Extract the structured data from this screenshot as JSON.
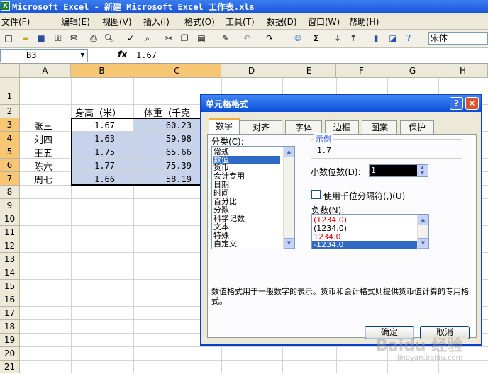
{
  "window": {
    "title": "Microsoft Excel - 新建 Microsoft Excel 工作表.xls",
    "app_icon": "X"
  },
  "menu": [
    "文件(F)",
    "编辑(E)",
    "视图(V)",
    "插入(I)",
    "格式(O)",
    "工具(T)",
    "数据(D)",
    "窗口(W)",
    "帮助(H)"
  ],
  "toolbar": {
    "font": "宋体",
    "sigma": "Σ"
  },
  "formula_bar": {
    "cell_ref": "B3",
    "fx": "fx",
    "value": "1.67"
  },
  "sheet": {
    "columns": [
      "A",
      "B",
      "C",
      "D",
      "E",
      "F",
      "G",
      "H"
    ],
    "rows": [
      "1",
      "2",
      "3",
      "4",
      "5",
      "6",
      "7",
      "8",
      "9",
      "10",
      "11",
      "12",
      "13",
      "14",
      "15",
      "16",
      "17",
      "18",
      "19",
      "20",
      "21"
    ],
    "headers": {
      "height": "身高（米）",
      "weight": "体重（千克"
    },
    "data": [
      {
        "name": "张三",
        "height": "1.67",
        "weight": "60.23"
      },
      {
        "name": "刘四",
        "height": "1.63",
        "weight": "59.98"
      },
      {
        "name": "王五",
        "height": "1.75",
        "weight": "65.66"
      },
      {
        "name": "陈六",
        "height": "1.77",
        "weight": "75.39"
      },
      {
        "name": "周七",
        "height": "1.66",
        "weight": "58.19"
      }
    ]
  },
  "dialog": {
    "title": "单元格格式",
    "help": "?",
    "close": "✕",
    "tabs": [
      "数字",
      "对齐",
      "字体",
      "边框",
      "图案",
      "保护"
    ],
    "category_label": "分类(C):",
    "categories": [
      "常规",
      "数值",
      "货币",
      "会计专用",
      "日期",
      "时间",
      "百分比",
      "分数",
      "科学记数",
      "文本",
      "特殊",
      "自定义"
    ],
    "selected_category": "数值",
    "sample_label": "示例",
    "sample_value": "1.7",
    "decimal_label": "小数位数(D):",
    "decimal_value": "1",
    "thousands_label": "使用千位分隔符(,)(U)",
    "negative_label": "负数(N):",
    "negative_options": [
      "(1234.0)",
      "(1234.0)",
      "1234.0",
      "-1234.0"
    ],
    "description": "数值格式用于一般数字的表示。货币和会计格式则提供货币值计算的专用格式。",
    "ok": "确定",
    "cancel": "取消"
  },
  "watermark": {
    "main": "Baidu 经验",
    "sub": "jingyan.baidu.com"
  }
}
